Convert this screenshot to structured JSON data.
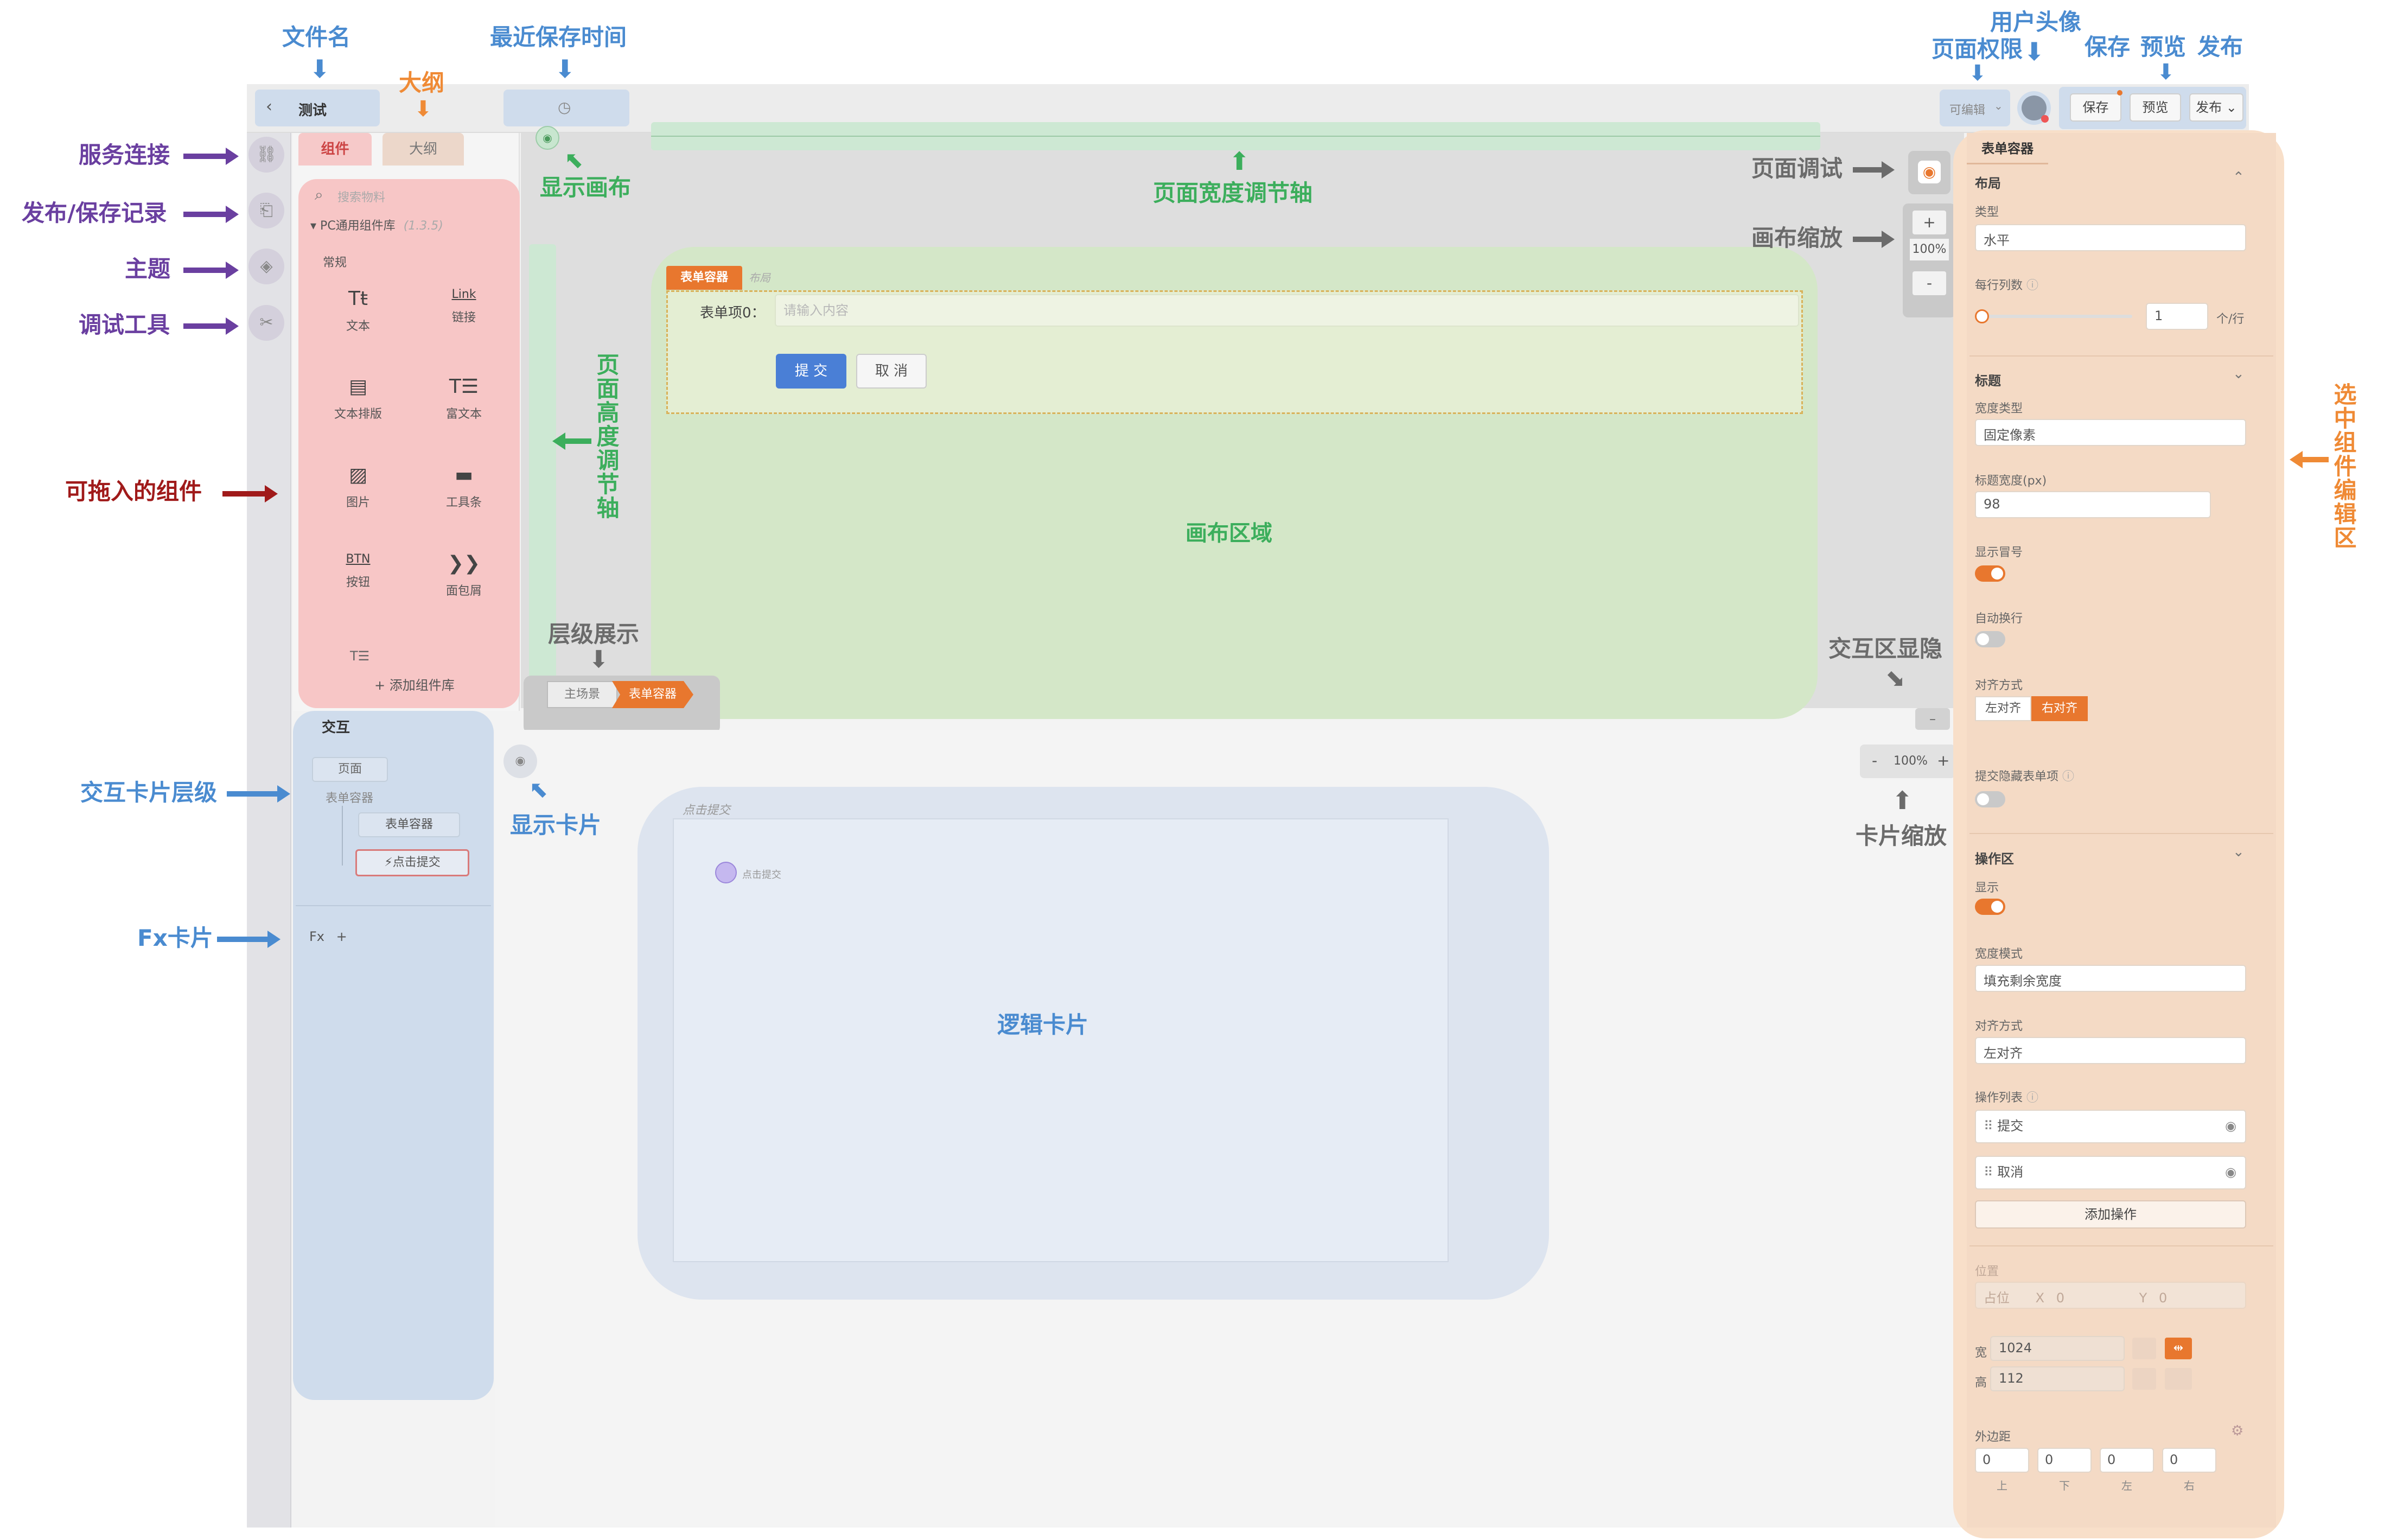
{
  "annotations": {
    "file_name": "文件名",
    "outline_label": "大纲",
    "last_save_time": "最近保存时间",
    "user_avatar": "用户头像",
    "page_permission": "页面权限",
    "save": "保存",
    "preview": "预览",
    "publish": "发布",
    "service_connect": "服务连接",
    "publish_save_record": "发布/保存记录",
    "theme": "主题",
    "debug_tools": "调试工具",
    "draggable_components": "可拖入的组件",
    "show_canvas": "显示画布",
    "page_width_axis": "页面宽度调节轴",
    "page_height_axis": "页面高度调节轴",
    "page_debug": "页面调试",
    "canvas_zoom": "画布缩放",
    "canvas_area": "画布区域",
    "layer_display": "层级展示",
    "interaction_toggle": "交互区显隐",
    "interaction_card_level": "交互卡片层级",
    "show_card": "显示卡片",
    "card_zoom": "卡片缩放",
    "fx_card": "Fx卡片",
    "logic_card": "逻辑卡片",
    "selected_editor": "选中组件编辑区"
  },
  "topbar": {
    "file_name": "测试",
    "back_icon": "chevron-left-icon",
    "permission": "可编辑",
    "save": "保存",
    "preview": "预览",
    "publish": "发布"
  },
  "left_panel": {
    "tab_components": "组件",
    "tab_outline": "大纲",
    "search_placeholder": "搜索物料",
    "library": "PC通用组件库",
    "library_version": "(1.3.5)",
    "group": "常规",
    "components": [
      {
        "icon": "Tŧ",
        "label": "文本"
      },
      {
        "icon": "Link",
        "label": "链接"
      },
      {
        "icon": "▤",
        "label": "文本排版"
      },
      {
        "icon": "T☰",
        "label": "富文本"
      },
      {
        "icon": "▨",
        "label": "图片"
      },
      {
        "icon": "▬",
        "label": "工具条"
      },
      {
        "icon": "BTN",
        "label": "按钮"
      },
      {
        "icon": "❯❯",
        "label": "面包屑"
      }
    ],
    "add_library": "+ 添加组件库"
  },
  "canvas": {
    "container_tag": "表单容器",
    "container_hint": "布局",
    "form_label": "表单项0：",
    "form_placeholder": "请输入内容",
    "submit": "提 交",
    "cancel": "取 消",
    "zoom": "100%",
    "zoom_plus": "+",
    "zoom_minus": "-",
    "breadcrumb_root": "主场景",
    "breadcrumb_current": "表单容器"
  },
  "interaction_panel": {
    "title": "交互",
    "page": "页面",
    "form_container": "表单容器",
    "form_container_child": "表单容器",
    "click_submit": "⚡点击提交",
    "fx": "Fx",
    "fx_add": "+"
  },
  "logic": {
    "card_title": "点击提交",
    "node_label": "点击提交",
    "zoom": "100%",
    "zoom_minus": "-",
    "zoom_plus": "+"
  },
  "right_panel": {
    "tab": "表单容器",
    "layout_section": "布局",
    "type_label": "类型",
    "type_value": "水平",
    "cols_label": "每行列数",
    "cols_value": "1",
    "cols_unit": "个/行",
    "title_section": "标题",
    "width_type_label": "宽度类型",
    "width_type_value": "固定像素",
    "title_width_label": "标题宽度(px)",
    "title_width_value": "98",
    "show_colon": "显示冒号",
    "auto_wrap": "自动换行",
    "align_label": "对齐方式",
    "align_left": "左对齐",
    "align_right": "右对齐",
    "hide_on_submit": "提交隐藏表单项",
    "action_section": "操作区",
    "show_label": "显示",
    "width_mode_label": "宽度模式",
    "width_mode_value": "填充剩余宽度",
    "action_align_label": "对齐方式",
    "action_align_value": "左对齐",
    "action_list_label": "操作列表",
    "action_items": [
      "提交",
      "取消"
    ],
    "add_action": "添加操作",
    "position_label": "位置",
    "position_value": "占位",
    "x_label": "X",
    "x_value": "0",
    "y_label": "Y",
    "y_value": "0",
    "width_label": "宽",
    "width_value": "1024",
    "height_label": "高",
    "height_value": "112",
    "margin_label": "外边距",
    "margins": [
      "0",
      "0",
      "0",
      "0"
    ],
    "margin_sides": [
      "上",
      "下",
      "左",
      "右"
    ]
  },
  "colors": {
    "accent_orange": "#e8772e",
    "primary_blue": "#4a7fd6",
    "annotation_purple": "#6a3fa0",
    "annotation_green": "#3cae5c",
    "annotation_blue": "#4a8bd0"
  }
}
